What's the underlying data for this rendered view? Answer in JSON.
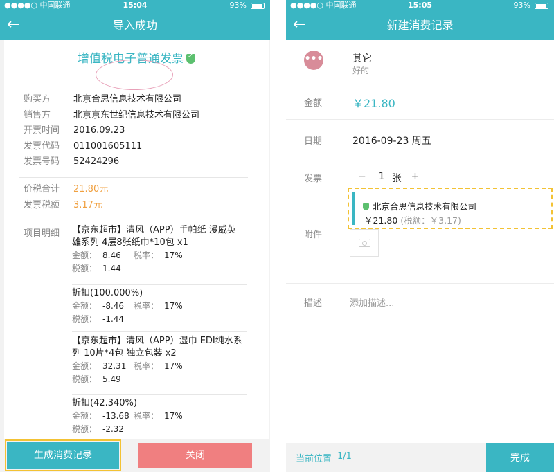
{
  "left": {
    "status": {
      "carrier": "●●●●○ 中国联通",
      "time": "15:04",
      "battery": "93%"
    },
    "nav": {
      "back": "←",
      "title": "导入成功"
    },
    "invoice_title": "增值税电子普通发票",
    "fields": [
      {
        "key": "购买方",
        "value": "北京合思信息技术有限公司"
      },
      {
        "key": "销售方",
        "value": "北京京东世纪信息技术有限公司"
      },
      {
        "key": "开票时间",
        "value": "2016.09.23"
      },
      {
        "key": "发票代码",
        "value": "011001605111"
      },
      {
        "key": "发票号码",
        "value": "52424296"
      }
    ],
    "totals": [
      {
        "key": "价税合计",
        "value": "21.80元"
      },
      {
        "key": "发票税额",
        "value": "3.17元"
      }
    ],
    "detail_key": "项目明细",
    "items": [
      {
        "name1": "【京东超市】清风（APP）手帕纸 漫威英",
        "name2": "雄系列 4层8张纸巾*10包 x1",
        "amount_label": "金额：",
        "amount": "8.46",
        "rate_label": "税率：",
        "rate": "17%",
        "tax_label": "税额：",
        "tax": "1.44"
      },
      {
        "name1": "折扣(100.000%)",
        "name2": "",
        "amount_label": "金额：",
        "amount": "-8.46",
        "rate_label": "税率：",
        "rate": "17%",
        "tax_label": "税额：",
        "tax": "-1.44"
      },
      {
        "name1": "【京东超市】清风（APP）湿巾 EDI纯水系",
        "name2": "列 10片*4包 独立包装 x2",
        "amount_label": "金额：",
        "amount": "32.31",
        "rate_label": "税率：",
        "rate": "17%",
        "tax_label": "税额：",
        "tax": "5.49"
      },
      {
        "name1": "折扣(42.340%)",
        "name2": "",
        "amount_label": "金额：",
        "amount": "-13.68",
        "rate_label": "税率：",
        "rate": "17%",
        "tax_label": "税额：",
        "tax": "-2.32"
      }
    ],
    "buttons": {
      "generate": "生成消费记录",
      "close": "关闭"
    }
  },
  "right": {
    "status": {
      "carrier": "●●●●○ 中国联通",
      "time": "15:05",
      "battery": "93%"
    },
    "nav": {
      "back": "←",
      "title": "新建消费记录"
    },
    "category": {
      "icon": "•••",
      "name": "其它",
      "sub": "好的"
    },
    "amount_label": "金额",
    "amount": "￥21.80",
    "date_label": "日期",
    "date": "2016-09-23 周五",
    "invoice_label": "发票",
    "stepper": {
      "minus": "−",
      "count": "1",
      "unit": "张",
      "plus": "+"
    },
    "invoice_card": {
      "seller": "北京合思信息技术有限公司",
      "amount": "￥21.80",
      "tax": "(税额：￥3.17)"
    },
    "attach_label": "附件",
    "desc_label": "描述",
    "desc_placeholder": "添加描述...",
    "footer": {
      "pos_label": "当前位置",
      "pos_value": "1/1",
      "done": "完成"
    }
  }
}
